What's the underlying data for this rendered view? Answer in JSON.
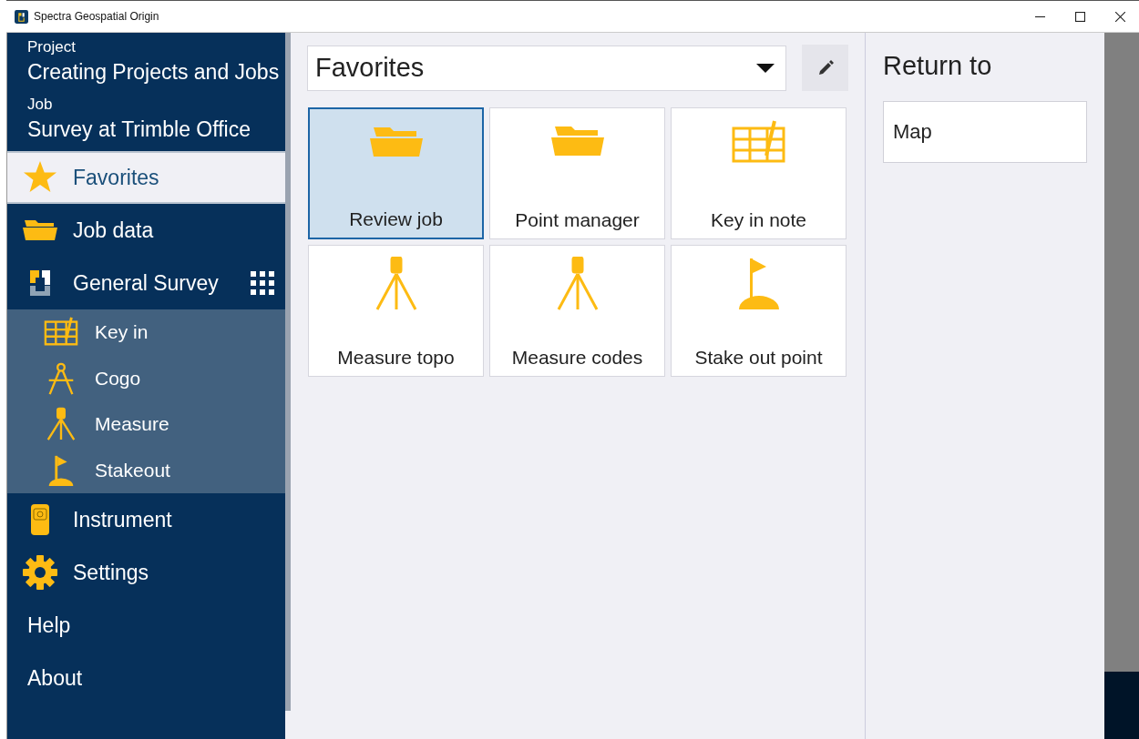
{
  "window": {
    "title": "Spectra Geospatial Origin"
  },
  "sidebar": {
    "project": {
      "label": "Project",
      "value": "Creating Projects and Jobs"
    },
    "job": {
      "label": "Job",
      "value": "Survey at Trimble Office"
    },
    "items": [
      {
        "label": "Favorites",
        "selected": true
      },
      {
        "label": "Job data",
        "selected": false
      },
      {
        "label": "General Survey",
        "selected": false,
        "expanded": true,
        "children": [
          {
            "label": "Key in",
            "selected": false
          },
          {
            "label": "Cogo",
            "selected": false
          },
          {
            "label": "Measure",
            "selected": false
          },
          {
            "label": "Stakeout",
            "selected": false
          }
        ]
      },
      {
        "label": "Instrument",
        "selected": false
      },
      {
        "label": "Settings",
        "selected": false
      },
      {
        "label": "Help",
        "selected": false
      },
      {
        "label": "About",
        "selected": false
      }
    ]
  },
  "main": {
    "dropdown": {
      "value": "Favorites"
    },
    "tiles": [
      {
        "label": "Review job",
        "selected": true
      },
      {
        "label": "Point manager",
        "selected": false
      },
      {
        "label": "Key in note",
        "selected": false
      },
      {
        "label": "Measure topo",
        "selected": false
      },
      {
        "label": "Measure codes",
        "selected": false
      },
      {
        "label": "Stake out point",
        "selected": false
      }
    ]
  },
  "return_panel": {
    "title": "Return to",
    "items": [
      "Map"
    ]
  }
}
